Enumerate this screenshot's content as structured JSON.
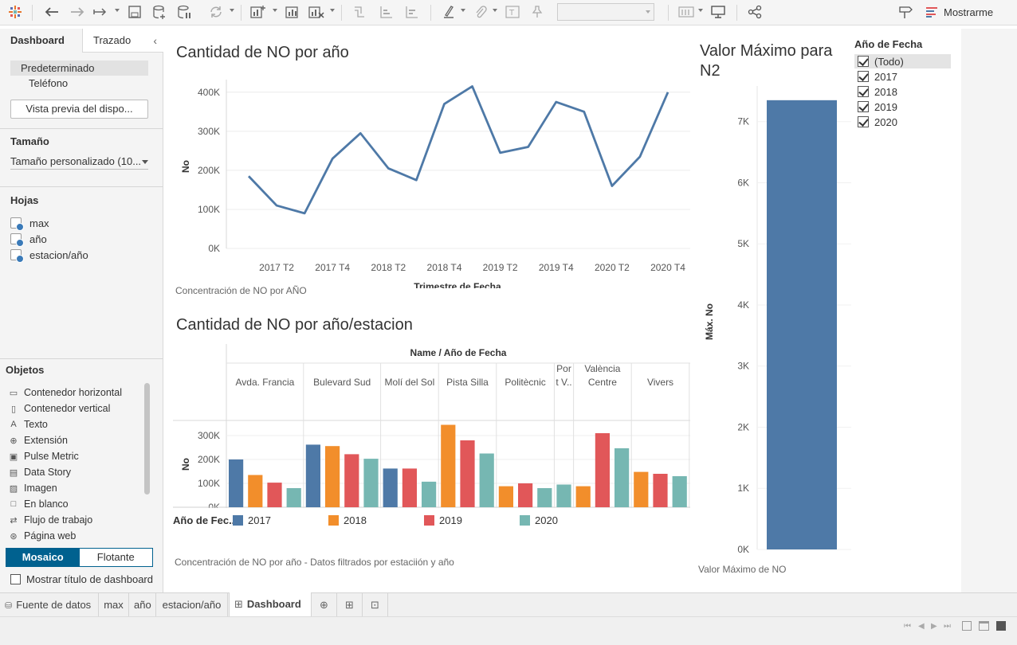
{
  "toolbar": {
    "show_me_label": "Mostrarme"
  },
  "colors": {
    "y2017": "#4e79a7",
    "y2018": "#f28e2b",
    "y2019": "#e15759",
    "y2020": "#76b7b2",
    "accent": "#00618f"
  },
  "sidebar": {
    "tabs": [
      "Dashboard",
      "Trazado"
    ],
    "device_options": [
      "Predeterminado",
      "Teléfono"
    ],
    "preview_button": "Vista previa del dispo...",
    "size_heading": "Tamaño",
    "size_value": "Tamaño personalizado (10...",
    "sheets_heading": "Hojas",
    "sheets": [
      "max",
      "año",
      "estacion/año"
    ],
    "objects_heading": "Objetos",
    "objects": [
      {
        "label": "Contenedor horizontal",
        "icon": "horizontal-container-icon",
        "glyph": "▭"
      },
      {
        "label": "Contenedor vertical",
        "icon": "vertical-container-icon",
        "glyph": "▯"
      },
      {
        "label": "Texto",
        "icon": "text-icon",
        "glyph": "A"
      },
      {
        "label": "Extensión",
        "icon": "extension-icon",
        "glyph": "⊕"
      },
      {
        "label": "Pulse Metric",
        "icon": "pulse-metric-icon",
        "glyph": "▣"
      },
      {
        "label": "Data Story",
        "icon": "data-story-icon",
        "glyph": "▤"
      },
      {
        "label": "Imagen",
        "icon": "image-icon",
        "glyph": "▨"
      },
      {
        "label": "En blanco",
        "icon": "blank-icon",
        "glyph": "□"
      },
      {
        "label": "Flujo de trabajo",
        "icon": "workflow-icon",
        "glyph": "⇄"
      },
      {
        "label": "Página web",
        "icon": "web-page-icon",
        "glyph": "⊛"
      }
    ],
    "layout_toggle": [
      "Mosaico",
      "Flotante"
    ],
    "show_title_label": "Mostrar título de dashboard"
  },
  "dashboard": {
    "line_title": "Cantidad de NO por año",
    "line_caption": "Concentración de NO por AÑO",
    "bar_title": "Cantidad de NO por año/estacion",
    "bar_caption": "Concentración de NO por año - Datos filtrados por estaciión y año",
    "max_title": "Valor Máximo para N2",
    "max_caption": "Valor Máximo de NO",
    "filter_title": "Año de Fecha",
    "filter_options": [
      "(Todo)",
      "2017",
      "2018",
      "2019",
      "2020"
    ],
    "legend_title": "Año de Fec..",
    "legend_items": [
      "2017",
      "2018",
      "2019",
      "2020"
    ]
  },
  "bottom_tabs": [
    "Fuente de datos",
    "max",
    "año",
    "estacion/año",
    "Dashboard 1"
  ],
  "chart_data": [
    {
      "type": "line",
      "title": "Cantidad de NO por año",
      "xlabel": "Trimestre de Fecha",
      "ylabel": "No",
      "x_ticks": [
        "2017 T2",
        "2017 T4",
        "2018 T2",
        "2018 T4",
        "2019 T2",
        "2019 T4",
        "2020 T2",
        "2020 T4"
      ],
      "x": [
        "2017 T1",
        "2017 T2",
        "2017 T3",
        "2017 T4",
        "2018 T1",
        "2018 T2",
        "2018 T3",
        "2018 T4",
        "2019 T1",
        "2019 T2",
        "2019 T3",
        "2019 T4",
        "2020 T1",
        "2020 T2",
        "2020 T3",
        "2020 T4"
      ],
      "series": [
        {
          "values": [
            185000,
            110000,
            90000,
            230000,
            295000,
            205000,
            175000,
            370000,
            415000,
            245000,
            260000,
            375000,
            350000,
            160000,
            235000,
            400000
          ]
        }
      ],
      "y_ticks": [
        "0K",
        "100K",
        "200K",
        "300K",
        "400K"
      ],
      "ylim": [
        0,
        420000
      ],
      "grid": true
    },
    {
      "type": "bar",
      "title": "Cantidad de NO por año/estacion",
      "xlabel": "Name / Año de Fecha",
      "ylabel": "No",
      "y_ticks": [
        "0K",
        "100K",
        "200K",
        "300K"
      ],
      "ylim": [
        0,
        350000
      ],
      "legend": "bottom",
      "groups": [
        {
          "name": "Avda. Francia",
          "bars": [
            {
              "year": "2017",
              "value": 200000
            },
            {
              "year": "2018",
              "value": 135000
            },
            {
              "year": "2019",
              "value": 103000
            },
            {
              "year": "2020",
              "value": 80000
            }
          ]
        },
        {
          "name": "Bulevard Sud",
          "bars": [
            {
              "year": "2017",
              "value": 262000
            },
            {
              "year": "2018",
              "value": 256000
            },
            {
              "year": "2019",
              "value": 222000
            },
            {
              "year": "2020",
              "value": 203000
            }
          ]
        },
        {
          "name": "Molí del Sol",
          "bars": [
            {
              "year": "2017",
              "value": 162000
            },
            {
              "year": "2019",
              "value": 162000
            },
            {
              "year": "2020",
              "value": 107000
            }
          ]
        },
        {
          "name": "Pista Silla",
          "bars": [
            {
              "year": "2018",
              "value": 345000
            },
            {
              "year": "2019",
              "value": 280000
            },
            {
              "year": "2020",
              "value": 225000
            }
          ]
        },
        {
          "name": "Politècnic",
          "bars": [
            {
              "year": "2018",
              "value": 88000
            },
            {
              "year": "2019",
              "value": 100000
            },
            {
              "year": "2020",
              "value": 80000
            }
          ]
        },
        {
          "name": "Por t V..",
          "bars": [
            {
              "year": "2020",
              "value": 95000
            }
          ]
        },
        {
          "name": "València Centre",
          "bars": [
            {
              "year": "2018",
              "value": 88000
            },
            {
              "year": "2019",
              "value": 310000
            },
            {
              "year": "2020",
              "value": 247000
            }
          ]
        },
        {
          "name": "Vivers",
          "bars": [
            {
              "year": "2018",
              "value": 148000
            },
            {
              "year": "2019",
              "value": 140000
            },
            {
              "year": "2020",
              "value": 130000
            }
          ]
        }
      ]
    },
    {
      "type": "bar",
      "title": "Valor Máximo para N2",
      "ylabel": "Máx. No",
      "y_ticks": [
        "0K",
        "1K",
        "2K",
        "3K",
        "4K",
        "5K",
        "6K",
        "7K"
      ],
      "ylim": [
        0,
        7400
      ],
      "values": [
        7350
      ]
    }
  ]
}
